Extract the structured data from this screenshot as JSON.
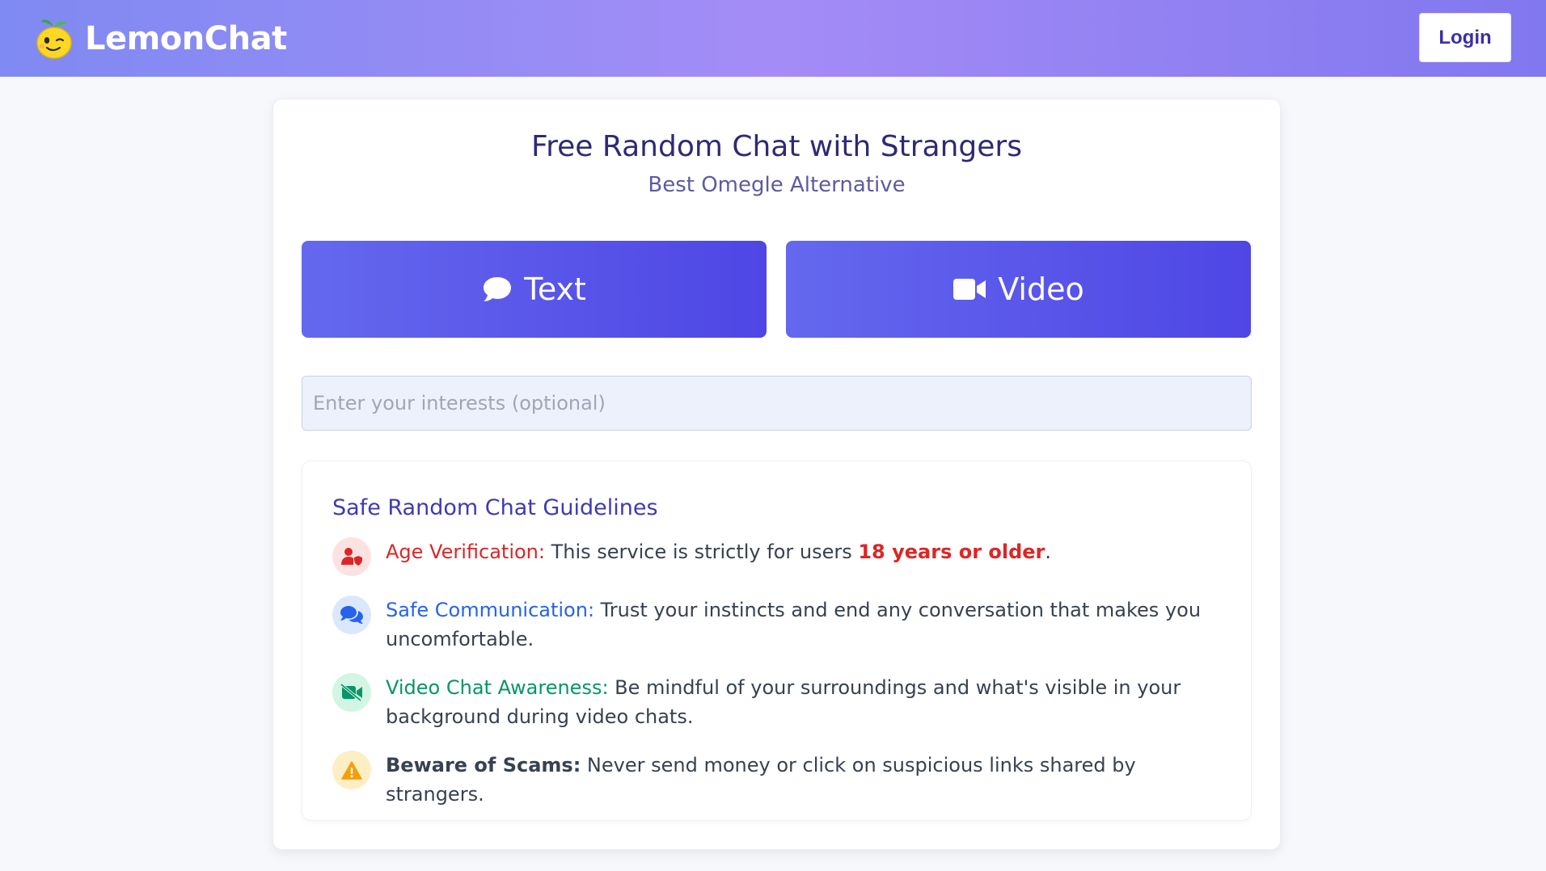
{
  "header": {
    "brand_name": "LemonChat",
    "login_label": "Login"
  },
  "hero": {
    "title": "Free Random Chat with Strangers",
    "subtitle": "Best Omegle Alternative"
  },
  "modes": {
    "text_label": "Text",
    "video_label": "Video"
  },
  "interests": {
    "placeholder": "Enter your interests (optional)",
    "value": ""
  },
  "guidelines": {
    "title": "Safe Random Chat Guidelines",
    "items": [
      {
        "icon": "user-shield-icon",
        "label": "Age Verification:",
        "text_before": " This service is strictly for users ",
        "emphasis": "18 years or older",
        "text_after": "."
      },
      {
        "icon": "comments-icon",
        "label": "Safe Communication:",
        "text": " Trust your instincts and end any conversation that makes you uncomfortable."
      },
      {
        "icon": "video-slash-icon",
        "label": "Video Chat Awareness:",
        "text": " Be mindful of your surroundings and what's visible in your background during video chats."
      },
      {
        "icon": "warning-icon",
        "label": "Beware of Scams:",
        "text": " Never send money or click on suspicious links shared by strangers."
      }
    ]
  },
  "colors": {
    "header_gradient": [
      "#7f8af2",
      "#a48cf6",
      "#8177ef"
    ],
    "primary_button": "#4f46e5",
    "age_label": "#dc2626",
    "communication_label": "#2563eb",
    "video_label": "#059669",
    "warning_icon": "#f59e0b"
  }
}
